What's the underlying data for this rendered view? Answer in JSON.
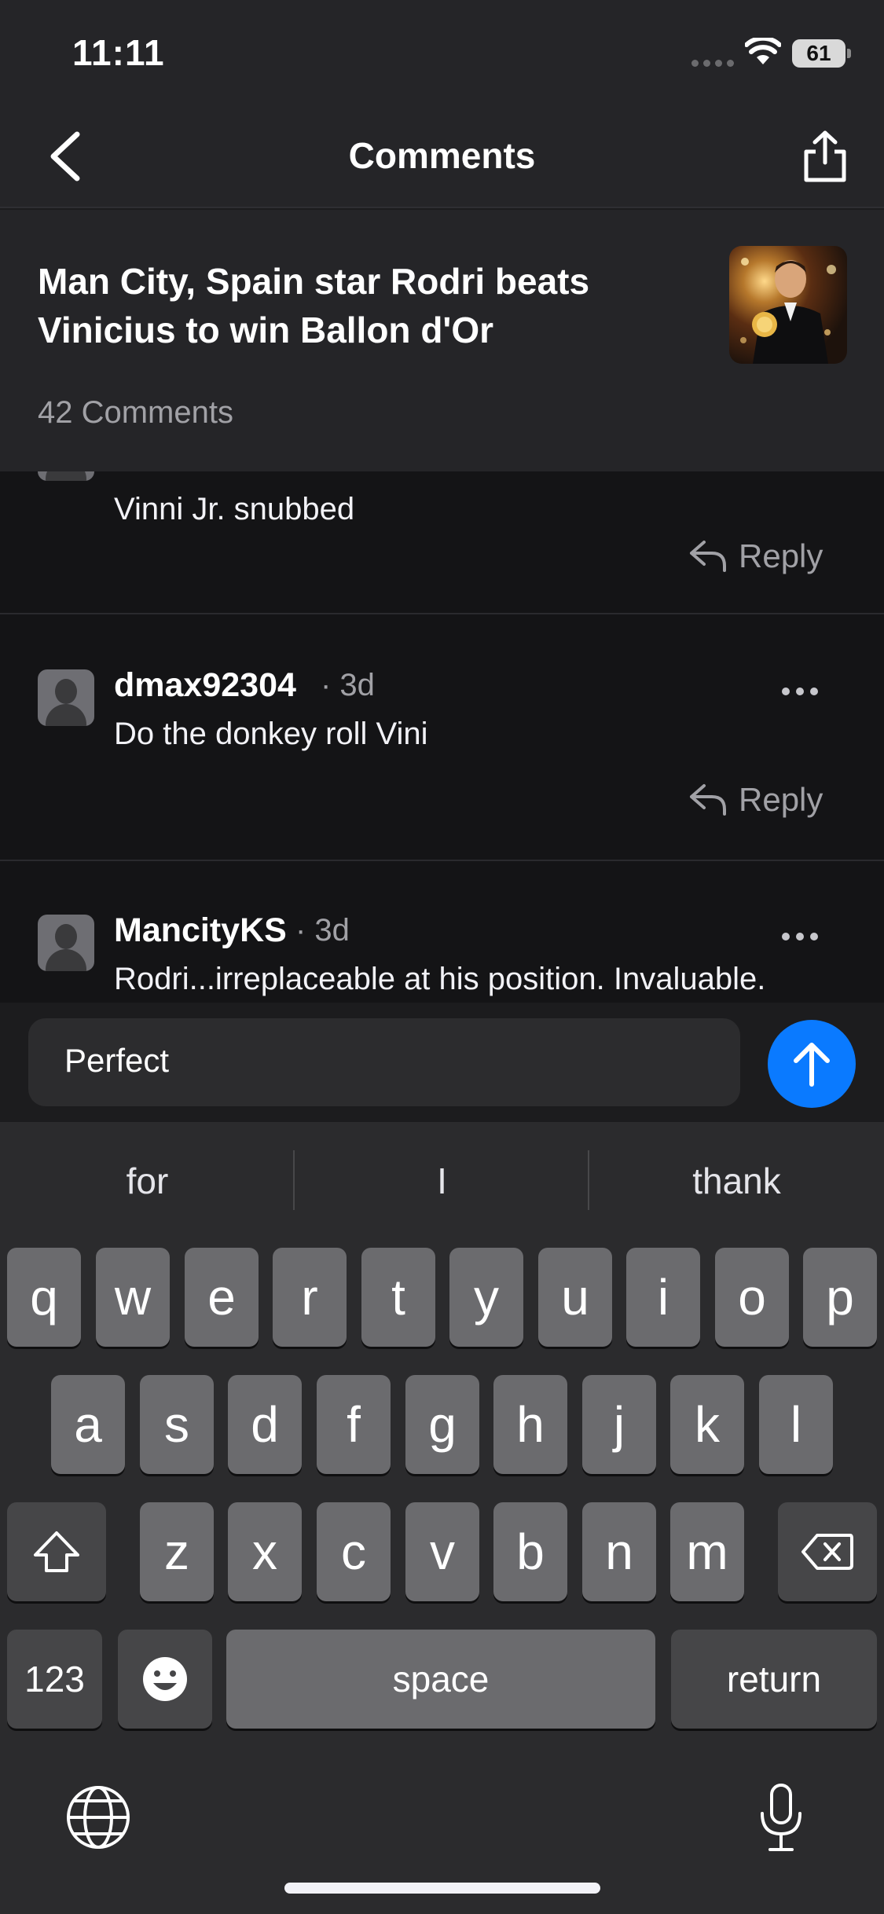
{
  "status": {
    "time": "11:11",
    "battery": "61"
  },
  "nav": {
    "title": "Comments",
    "back_icon": "chevron-left-icon",
    "share_icon": "share-icon"
  },
  "article": {
    "title": "Man City, Spain star Rodri beats Vinicius to win Ballon d'Or",
    "comment_count": "42 Comments"
  },
  "comments": [
    {
      "text": "Vinni Jr. snubbed",
      "reply_label": "Reply"
    },
    {
      "username": "dmax92304",
      "age": "· 3d",
      "text": "Do the donkey roll Vini",
      "reply_label": "Reply"
    },
    {
      "username": "MancityKS",
      "age": "· 3d",
      "text": "Rodri...irreplaceable at his position.  Invaluable."
    }
  ],
  "composer": {
    "value": "Perfect",
    "send_icon": "arrow-up-icon"
  },
  "keyboard": {
    "suggestions": [
      "for",
      "I",
      "thank"
    ],
    "row1": [
      "q",
      "w",
      "e",
      "r",
      "t",
      "y",
      "u",
      "i",
      "o",
      "p"
    ],
    "row2": [
      "a",
      "s",
      "d",
      "f",
      "g",
      "h",
      "j",
      "k",
      "l"
    ],
    "row3": [
      "z",
      "x",
      "c",
      "v",
      "b",
      "n",
      "m"
    ],
    "numbers_label": "123",
    "space_label": "space",
    "return_label": "return"
  },
  "colors": {
    "accent": "#0a7aff",
    "background": "#1c1c1e"
  }
}
